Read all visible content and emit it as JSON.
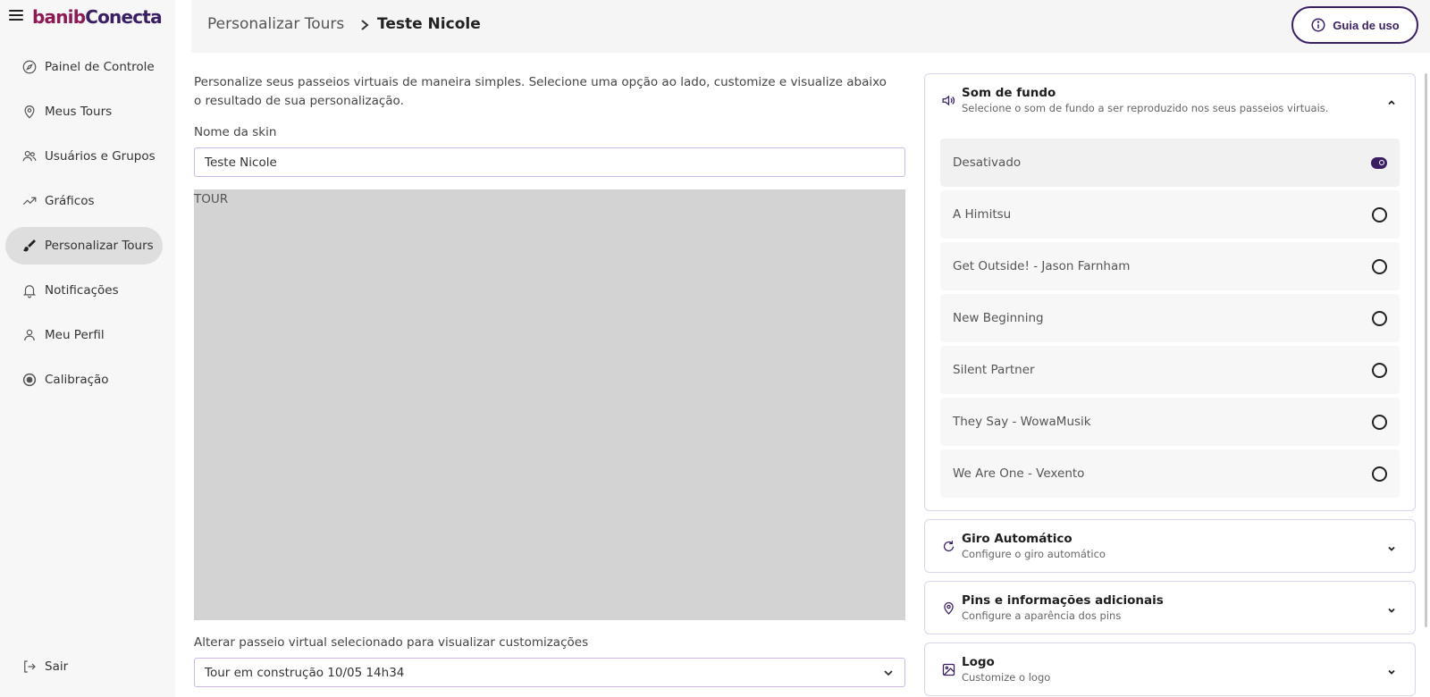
{
  "brand": {
    "logo_prefix": "banib",
    "logo_suffix": "Conecta"
  },
  "sidebar": {
    "items": [
      {
        "label": "Painel de Controle",
        "icon": "compass-icon"
      },
      {
        "label": "Meus Tours",
        "icon": "map-pin-icon"
      },
      {
        "label": "Usuários e Grupos",
        "icon": "users-icon"
      },
      {
        "label": "Gráficos",
        "icon": "trending-up-icon"
      },
      {
        "label": "Personalizar Tours",
        "icon": "brush-icon",
        "active": true
      },
      {
        "label": "Notificações",
        "icon": "bell-icon"
      },
      {
        "label": "Meu Perfil",
        "icon": "user-icon"
      },
      {
        "label": "Calibração",
        "icon": "target-icon"
      }
    ],
    "logout_label": "Sair"
  },
  "header": {
    "breadcrumb_parent": "Personalizar Tours",
    "breadcrumb_current": "Teste Nicole",
    "guide_label": "Guia de uso"
  },
  "main": {
    "intro": "Personalize seus passeios virtuais de maneira simples. Selecione uma opção ao lado, customize e visualize abaixo o resultado de sua personalização.",
    "skin_label": "Nome da skin",
    "skin_value": "Teste Nicole",
    "preview_label": "TOUR",
    "select_label": "Alterar passeio virtual selecionado para visualizar customizações",
    "select_value": "Tour em construção 10/05 14h34"
  },
  "panels": {
    "sound": {
      "title": "Som de fundo",
      "subtitle": "Selecione o som de fundo a ser reproduzido nos seus passeios virtuais.",
      "expanded": true,
      "selected": "Desativado",
      "options": [
        "Desativado",
        "A Himitsu",
        "Get Outside! - Jason Farnham",
        "New Beginning",
        "Silent Partner",
        "They Say - WowaMusik",
        "We Are One - Vexento"
      ]
    },
    "rotation": {
      "title": "Giro Automático",
      "subtitle": "Configure o giro automático"
    },
    "pins": {
      "title": "Pins e informações adicionais",
      "subtitle": "Configure a aparência dos pins"
    },
    "logo": {
      "title": "Logo",
      "subtitle": "Customize o logo"
    }
  },
  "colors": {
    "brand_primary": "#3a1f63",
    "brand_accent": "#8e1a55",
    "active_nav_bg": "#dedede",
    "preview_bg": "#d3d3d3"
  }
}
